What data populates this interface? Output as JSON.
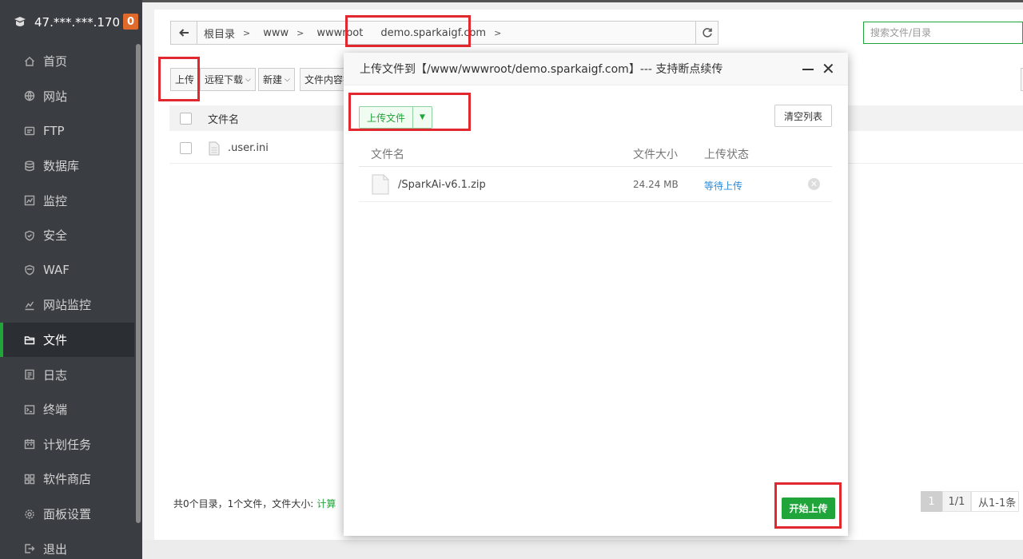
{
  "server": {
    "ip": "47.***.***.170",
    "badge": "0"
  },
  "sidebar": {
    "items": [
      {
        "label": "首页",
        "icon": "home-icon"
      },
      {
        "label": "网站",
        "icon": "globe-icon"
      },
      {
        "label": "FTP",
        "icon": "ftp-icon"
      },
      {
        "label": "数据库",
        "icon": "database-icon"
      },
      {
        "label": "监控",
        "icon": "monitor-icon"
      },
      {
        "label": "安全",
        "icon": "shield-icon"
      },
      {
        "label": "WAF",
        "icon": "waf-shield-icon"
      },
      {
        "label": "网站监控",
        "icon": "chart-icon"
      },
      {
        "label": "文件",
        "icon": "folder-icon"
      },
      {
        "label": "日志",
        "icon": "log-icon"
      },
      {
        "label": "终端",
        "icon": "terminal-icon"
      },
      {
        "label": "计划任务",
        "icon": "calendar-icon"
      },
      {
        "label": "软件商店",
        "icon": "apps-icon"
      },
      {
        "label": "面板设置",
        "icon": "gear-icon"
      },
      {
        "label": "退出",
        "icon": "logout-icon"
      }
    ],
    "active_index": 8
  },
  "path": {
    "crumbs": [
      "根目录",
      "www",
      "wwwroot",
      "demo.sparkaigf.com"
    ]
  },
  "search": {
    "placeholder": "搜索文件/目录"
  },
  "toolbar": {
    "upload": "上传",
    "remote_download": "远程下载",
    "new": "新建",
    "content_search": "文件内容搜"
  },
  "file_table": {
    "header_name": "文件名",
    "rows": [
      {
        "name": ".user.ini"
      }
    ]
  },
  "footer": {
    "summary": "共0个目录，1个文件，文件大小:",
    "calc": "计算"
  },
  "pagination": {
    "current": "1",
    "total": "1/1",
    "range": "从1-1条"
  },
  "modal": {
    "title": "上传文件到【/www/wwwroot/demo.sparkaigf.com】--- 支持断点续传",
    "upload_file_btn": "上传文件",
    "clear_list_btn": "清空列表",
    "columns": {
      "name": "文件名",
      "size": "文件大小",
      "status": "上传状态"
    },
    "files": [
      {
        "name": "/SparkAi-v6.1.zip",
        "size": "24.24 MB",
        "status": "等待上传"
      }
    ],
    "start_btn": "开始上传"
  },
  "colors": {
    "accent": "#20a53a",
    "annotation": "#e0282e",
    "sidebar_bg": "#3a3e43",
    "badge": "#e0692c",
    "link": "#2a8bd9"
  }
}
